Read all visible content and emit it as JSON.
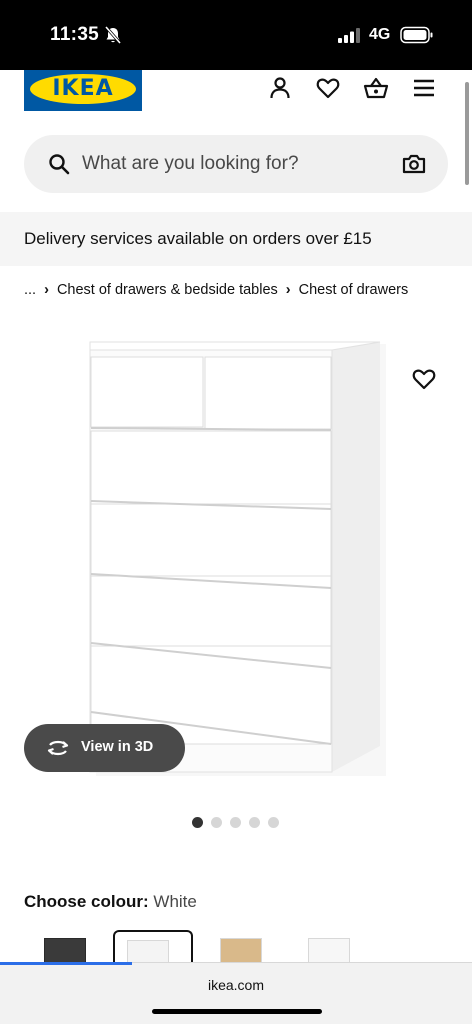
{
  "status_bar": {
    "time": "11:35",
    "network": "4G",
    "icons": [
      "bell-muted-icon",
      "signal-icon",
      "battery-icon"
    ]
  },
  "header": {
    "logo_text": "IKEA",
    "brand_colors": {
      "blue": "#0058a3",
      "yellow": "#ffdb00"
    },
    "icons": [
      "account-icon",
      "wishlist-heart-icon",
      "shopping-basket-icon",
      "menu-icon"
    ]
  },
  "search": {
    "placeholder": "What are you looking for?",
    "icons": [
      "search-icon",
      "camera-icon"
    ]
  },
  "banner": {
    "text": "Delivery services available on orders over £15"
  },
  "breadcrumb": {
    "ellipsis": "...",
    "separator": "›",
    "items": [
      "Chest of drawers & bedside tables",
      "Chest of drawers"
    ]
  },
  "product": {
    "view_3d_label": "View in 3D",
    "gallery": {
      "total": 5,
      "current": 1
    },
    "colour_label": "Choose colour:",
    "colour_value": "White",
    "swatches": [
      {
        "name": "black-brown",
        "color": "#3a3a3a",
        "selected": false
      },
      {
        "name": "white",
        "color": "#f4f4f4",
        "selected": true
      },
      {
        "name": "oak",
        "color": "#d9b98a",
        "selected": false
      },
      {
        "name": "white-gloss",
        "color": "#f7f7f7",
        "selected": false
      }
    ]
  },
  "browser": {
    "domain": "ikea.com",
    "load_color": "#2b6ee8"
  }
}
